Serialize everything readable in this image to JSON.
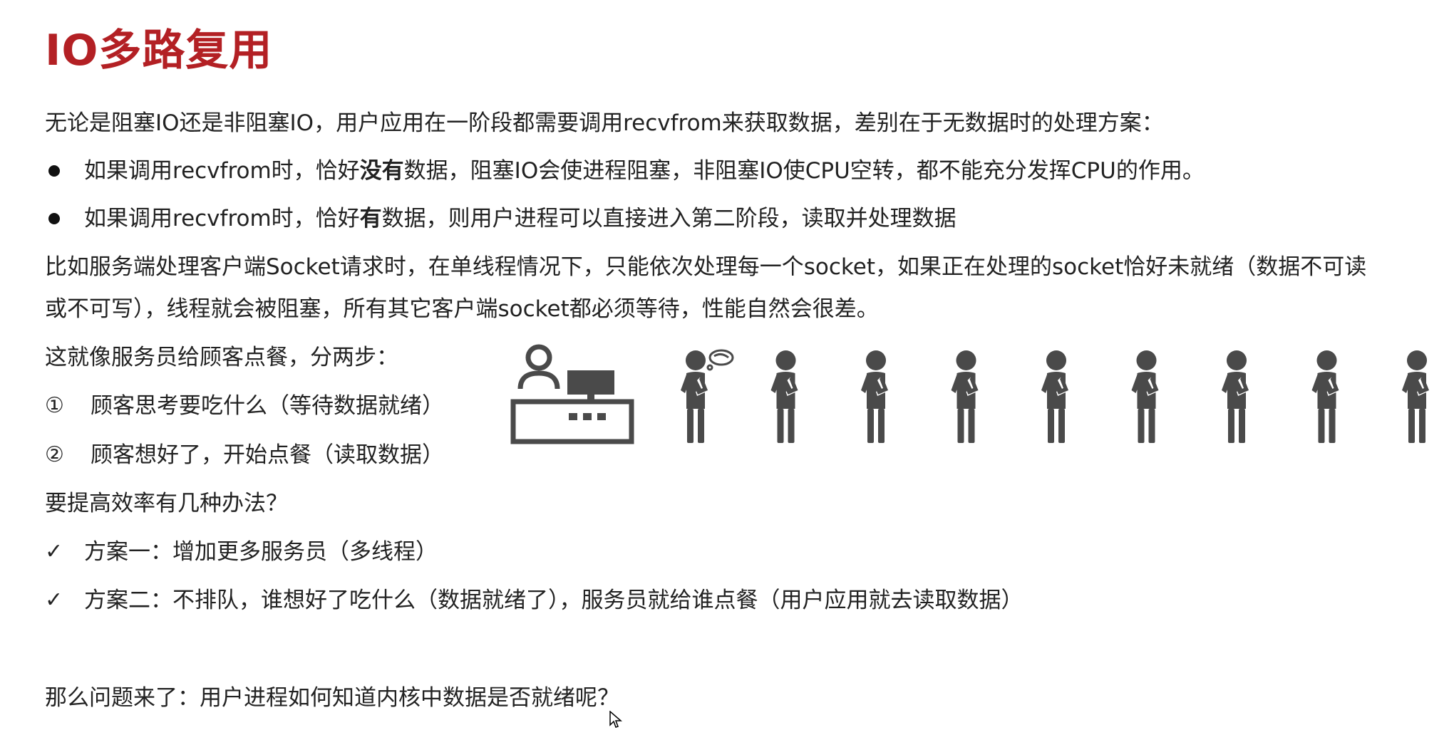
{
  "slide": {
    "title": "IO多路复用",
    "intro": "无论是阻塞IO还是非阻塞IO，用户应用在一阶段都需要调用recvfrom来获取数据，差别在于无数据时的处理方案：",
    "bullets": [
      {
        "pre": "如果调用recvfrom时，恰好",
        "bold": "没有",
        "post": "数据，阻塞IO会使进程阻塞，非阻塞IO使CPU空转，都不能充分发挥CPU的作用。"
      },
      {
        "pre": "如果调用recvfrom时，恰好",
        "bold": "有",
        "post": "数据，则用户进程可以直接进入第二阶段，读取并处理数据"
      }
    ],
    "example_line1": "比如服务端处理客户端Socket请求时，在单线程情况下，只能依次处理每一个socket，如果正在处理的socket恰好未就绪（数据不可读",
    "example_line2": "或不可写），线程就会被阻塞，所有其它客户端socket都必须等待，性能自然会很差。",
    "analogy": "这就像服务员给顾客点餐，分两步：",
    "steps": [
      {
        "marker": "①",
        "text": "顾客思考要吃什么（等待数据就绪）"
      },
      {
        "marker": "②",
        "text": "顾客想好了，开始点餐（读取数据）"
      }
    ],
    "question": "要提高效率有几种办法？",
    "solutions": [
      {
        "marker": "✓",
        "text": "方案一：增加更多服务员（多线程）"
      },
      {
        "marker": "✓",
        "text": "方案二：不排队，谁想好了吃什么（数据就绪了），服务员就给谁点餐（用户应用就去读取数据）"
      }
    ],
    "conclusion": "那么问题来了：用户进程如何知道内核中数据是否就绪呢？"
  },
  "illustration": {
    "icons": [
      "cashier-counter-icon",
      "thinking-customer-icon",
      "customer-icon"
    ],
    "customer_count": 9,
    "icon_color": "#4a4a4a"
  },
  "colors": {
    "title": "#b32024",
    "text": "#222222",
    "icon": "#4a4a4a"
  }
}
